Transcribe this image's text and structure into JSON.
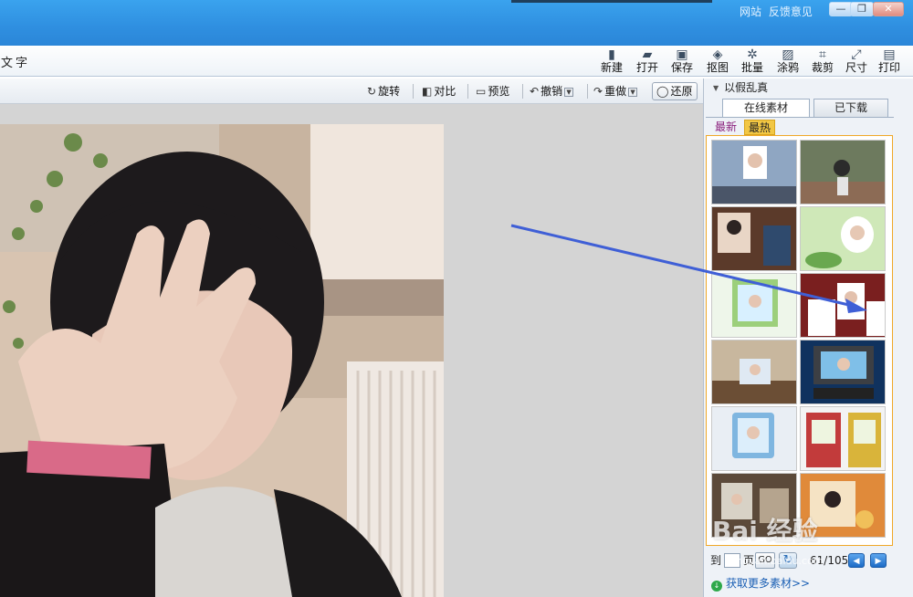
{
  "title_bar": {
    "links": [
      "网站",
      "反馈意见"
    ],
    "min": "—",
    "max": "❐",
    "close": "✕"
  },
  "toolbar": {
    "left_text": "文字",
    "buttons": [
      {
        "label": "新建",
        "icon": "new-file-icon"
      },
      {
        "label": "打开",
        "icon": "folder-open-icon"
      },
      {
        "label": "保存",
        "icon": "save-disk-icon"
      },
      {
        "label": "抠图",
        "icon": "cutout-icon"
      },
      {
        "label": "批量",
        "icon": "batch-gear-icon"
      },
      {
        "label": "涂鸦",
        "icon": "doodle-icon"
      },
      {
        "label": "裁剪",
        "icon": "crop-icon"
      },
      {
        "label": "尺寸",
        "icon": "resize-icon"
      },
      {
        "label": "打印",
        "icon": "printer-icon"
      }
    ]
  },
  "subbar": {
    "rotate": "旋转",
    "compare": "对比",
    "preview": "预览",
    "undo": "撤销",
    "redo": "重做",
    "restore": "还原"
  },
  "panel": {
    "header": "以假乱真",
    "tabs": [
      "在线素材",
      "已下载"
    ],
    "subtabs": [
      "最新",
      "最热"
    ],
    "pager": {
      "to": "到",
      "page": "页",
      "go": "GO",
      "info": "61/105"
    },
    "more_link": "获取更多素材>>"
  },
  "watermark": {
    "text": "Bai 经验",
    "url": "jingyan.baidu.com"
  },
  "colors": {
    "titlebar": "#2f8fe0",
    "accent_tab": "#f2c744",
    "arrow": "#3f5fd6",
    "link": "#1a5fb4"
  }
}
